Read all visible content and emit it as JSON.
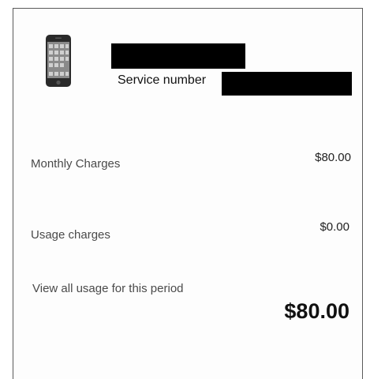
{
  "account": {
    "service_label": "Service number"
  },
  "charges": {
    "monthly_label": "Monthly Charges",
    "monthly_value": "$80.00",
    "usage_label": "Usage charges",
    "usage_value": "$0.00"
  },
  "links": {
    "view_usage": "View all usage for this period"
  },
  "total": {
    "amount": "$80.00"
  },
  "icons": {
    "device": "smartphone-icon"
  }
}
